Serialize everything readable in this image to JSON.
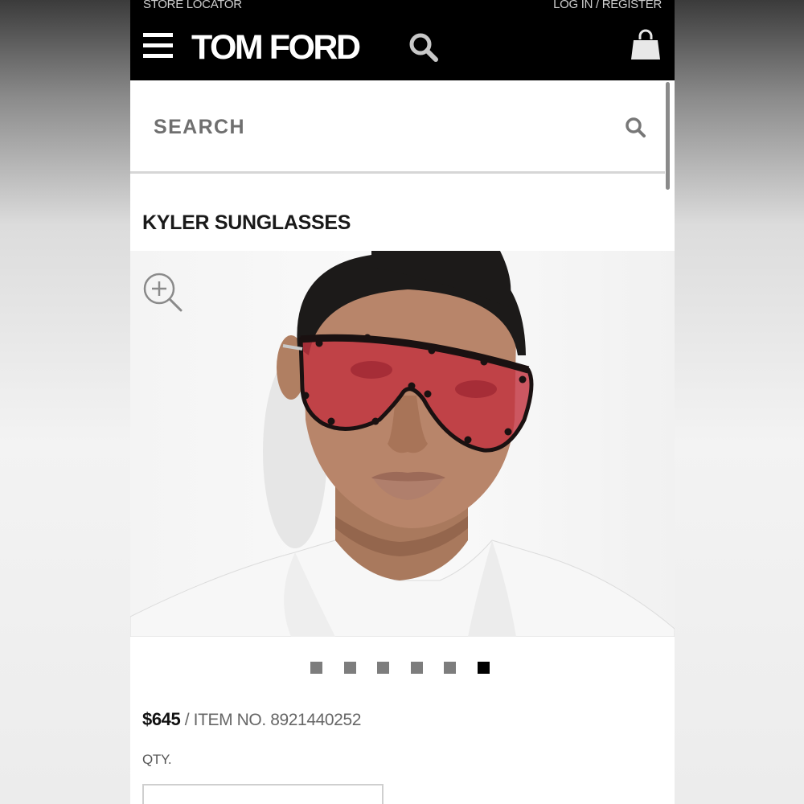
{
  "header": {
    "store_locator": "STORE LOCATOR",
    "login": "LOG IN / REGISTER",
    "logo": "TOM FORD"
  },
  "search": {
    "label": "SEARCH"
  },
  "product": {
    "title": "KYLER SUNGLASSES",
    "price": "$645",
    "item_no": " / ITEM NO. 8921440252",
    "qty_label": "QTY."
  },
  "gallery": {
    "total": 6,
    "active": 6
  },
  "colors": {
    "header_bg": "#000000",
    "lens": "#c2333f",
    "dot": "#7d7d7d",
    "dot_active": "#000000"
  }
}
